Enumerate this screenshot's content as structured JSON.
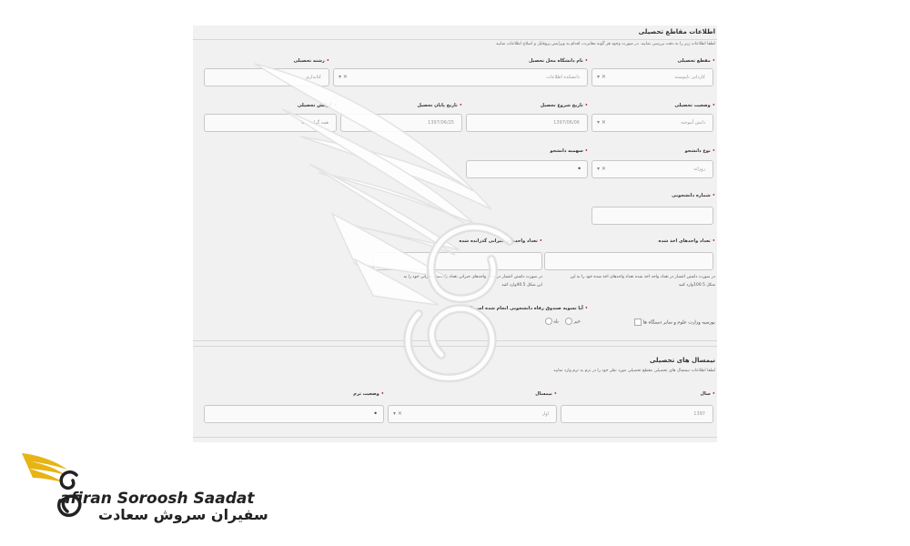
{
  "section1": {
    "title": "اطلاعات مقاطع تحصیلی",
    "desc": "لطفا اطلاعات زیر را به دقت بررسی نمایید. در صورت وجود هر گونه مغایرت، اقدام به ویرایش پروفایل و اصلاح اطلاعات نمایید"
  },
  "row1": {
    "grade_label": "مقطع تحصیلی",
    "grade_value": "کاردانی ناپیوسته",
    "university_label": "نام دانشگاه محل تحصیل",
    "university_value": "دانشکده اطلاعات",
    "major_label": "رشته تحصیلی",
    "major_value": "کتابداری"
  },
  "row2": {
    "status_label": "وضعیت تحصیلی",
    "status_value": "دانش آموخته",
    "start_label": "تاریخ شروع تحصیل",
    "start_value": "1397/06/06",
    "end_label": "تاریخ پایان تحصیل",
    "end_value": "1397/06/25",
    "orientation_label": "گرایش تحصیلی",
    "orientation_value": "همه گرایش ها"
  },
  "row3": {
    "student_type_label": "نوع دانشجو",
    "student_type_value": "روزانه",
    "quota_label": "سهمیه دانشجو"
  },
  "row4": {
    "student_number_label": "شماره دانشجویی"
  },
  "row5": {
    "units_label": "تعداد واحدهای اخذ شده",
    "comp_units_label": "تعداد واحدهای جبرانی گذرانده شده",
    "note_right_1": "در صورت داشتن اعشار در تعداد واحد اخذ شده تعداد واحدهای اخذ شده خود را به این",
    "note_right_2": "شکل 100.5وارد کنید",
    "note_left_1": "در صورت داشتن اعشار در تعداد واحدهای جبرانی تعداد واحدهای جبرانی خود را به",
    "note_left_2": "این شکل 40.5وارد کنید"
  },
  "row6": {
    "settlement_label": "آیا تسویه صندوق رفاه دانشجویی انجام شده است؟",
    "yes_label": "بله",
    "no_label": "خیر",
    "ministry_label": "بورسیه وزارت علوم و سایر دستگاه ها"
  },
  "section2": {
    "title": "نیمسال های تحصیلی",
    "desc": "لطفا اطلاعات نیمسال های تحصیلی مقطع تحصیلی مورد نظر خود را در ترم به ترم وارد نمایید",
    "year_label": "سال",
    "year_value": "1397",
    "semester_label": "نیمسال",
    "semester_value": "اول",
    "term_status_label": "وضعیت ترم"
  },
  "logo": {
    "en": "afiran Soroosh Saadat",
    "fa": "سفیران سروش سعادت",
    "gold": "#e7b416",
    "dark": "#222222"
  }
}
